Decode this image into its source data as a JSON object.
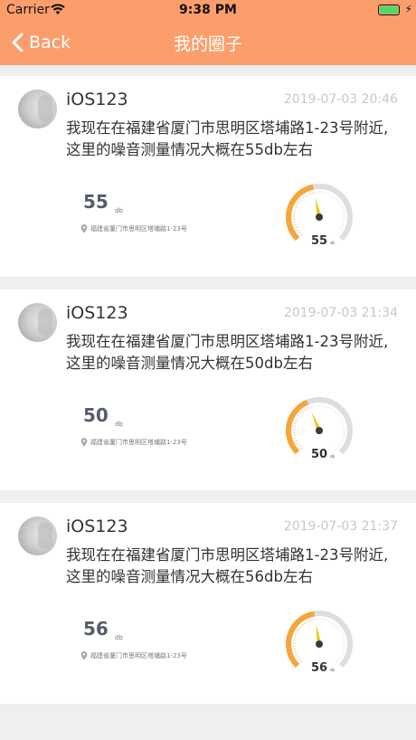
{
  "status": {
    "carrier": "Carrier",
    "time": "9:38 PM"
  },
  "nav": {
    "back_label": "Back",
    "title": "我的圈子"
  },
  "posts": [
    {
      "username": "iOS123",
      "time": "2019-07-03 20:46",
      "text": "我现在在福建省厦门市思明区塔埔路1-23号附近,这里的噪音测量情况大概在55db左右",
      "db": "55",
      "db_unit": "db",
      "location": "福建省厦门市思明区塔埔路1-23号",
      "gauge_value": 55
    },
    {
      "username": "iOS123",
      "time": "2019-07-03 21:34",
      "text": "我现在在福建省厦门市思明区塔埔路1-23号附近,这里的噪音测量情况大概在50db左右",
      "db": "50",
      "db_unit": "db",
      "location": "福建省厦门市思明区塔埔路1-23号",
      "gauge_value": 50
    },
    {
      "username": "iOS123",
      "time": "2019-07-03 21:37",
      "text": "我现在在福建省厦门市思明区塔埔路1-23号附近,这里的噪音测量情况大概在56db左右",
      "db": "56",
      "db_unit": "db",
      "location": "福建省厦门市思明区塔埔路1-23号",
      "gauge_value": 56
    }
  ],
  "colors": {
    "header": "#fc9e6c",
    "gauge_active": "#f5a53a",
    "gauge_track": "#dcdfe2",
    "needle": "#f0c419"
  }
}
